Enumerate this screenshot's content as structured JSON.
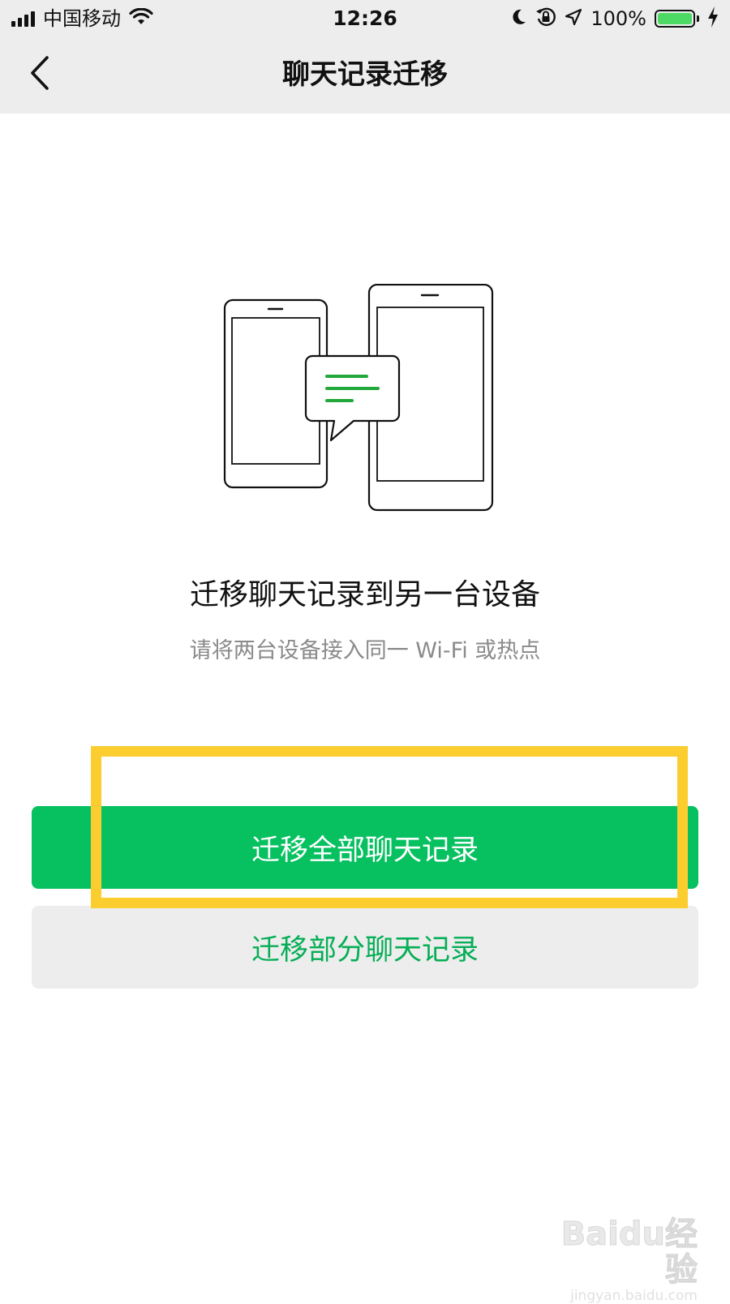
{
  "status_bar": {
    "carrier": "中国移动",
    "time": "12:26",
    "battery_percent": "100%",
    "battery_level": 1.0,
    "icons": [
      "signal-icon",
      "wifi-icon",
      "moon-icon",
      "orientation-lock-icon",
      "location-arrow-icon",
      "battery-icon",
      "charging-bolt-icon"
    ]
  },
  "nav": {
    "back_icon": "chevron-left-icon",
    "title": "聊天记录迁移"
  },
  "illustration": {
    "icon": "phones-transfer-illustration",
    "accent_color": "#22a83a"
  },
  "content": {
    "headline": "迁移聊天记录到另一台设备",
    "subline": "请将两台设备接入同一 Wi-Fi 或热点"
  },
  "actions": {
    "primary_label": "迁移全部聊天记录",
    "secondary_label": "迁移部分聊天记录",
    "primary_color": "#07c160",
    "secondary_text_color": "#06ae56"
  },
  "annotation": {
    "highlight_color": "#fbcd2e"
  },
  "watermark": {
    "logo": "Baidu经验",
    "url": "jingyan.baidu.com"
  }
}
